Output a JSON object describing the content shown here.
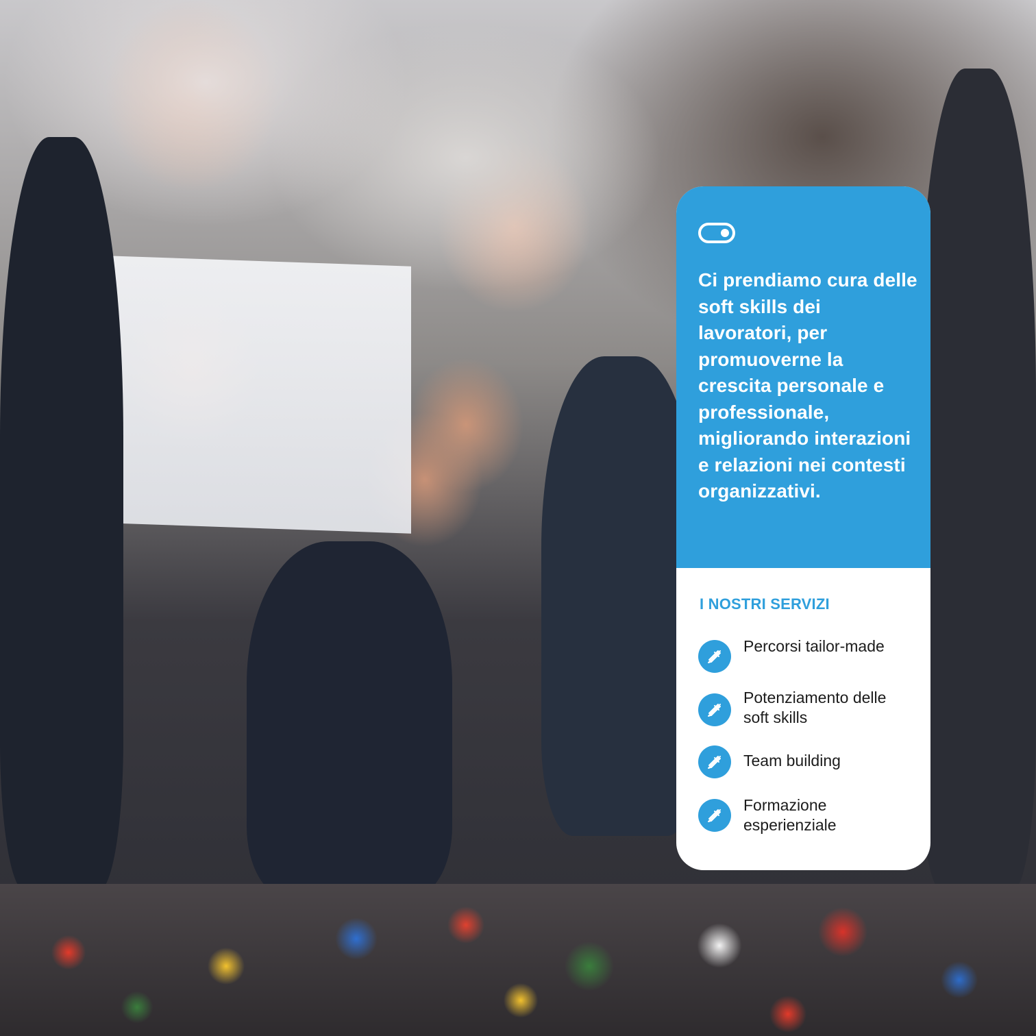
{
  "card": {
    "accent_color": "#2f9fdc",
    "top_icon": "toggle-switch-icon",
    "headline": "Ci prendiamo cura delle soft skills dei lavoratori, per promuoverne la crescita personale e professionale, migliorando interazioni e relazioni nei contesti organizzativi.",
    "services_title": "I NOSTRI SERVIZI",
    "services": [
      {
        "label": "Percorsi tailor-made",
        "icon": "rocket-icon"
      },
      {
        "label": "Potenziamento delle soft skills",
        "icon": "rocket-icon"
      },
      {
        "label": "Team building",
        "icon": "rocket-icon"
      },
      {
        "label": "Formazione esperienziale",
        "icon": "rocket-icon"
      }
    ]
  }
}
